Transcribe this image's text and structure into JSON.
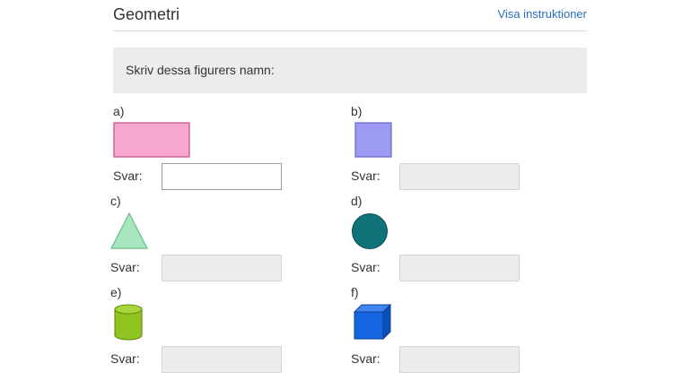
{
  "header": {
    "title": "Geometri",
    "instructions_link": "Visa instruktioner"
  },
  "prompt": "Skriv dessa figurers namn:",
  "answer_label": "Svar:",
  "colors": {
    "rectangle": "#f7a8d0",
    "square": "#9d9cf2",
    "triangle": "#a8e6c0",
    "circle": "#11737a",
    "cylinder": "#8fc31f",
    "cube": "#1565e0",
    "link": "#2a6dbf"
  },
  "tasks": [
    {
      "label": "a)",
      "shape": "rectangle-icon",
      "answer": ""
    },
    {
      "label": "b)",
      "shape": "square-icon",
      "answer": ""
    },
    {
      "label": "c)",
      "shape": "triangle-icon",
      "answer": ""
    },
    {
      "label": "d)",
      "shape": "circle-icon",
      "answer": ""
    },
    {
      "label": "e)",
      "shape": "cylinder-icon",
      "answer": ""
    },
    {
      "label": "f)",
      "shape": "cube-icon",
      "answer": ""
    }
  ]
}
